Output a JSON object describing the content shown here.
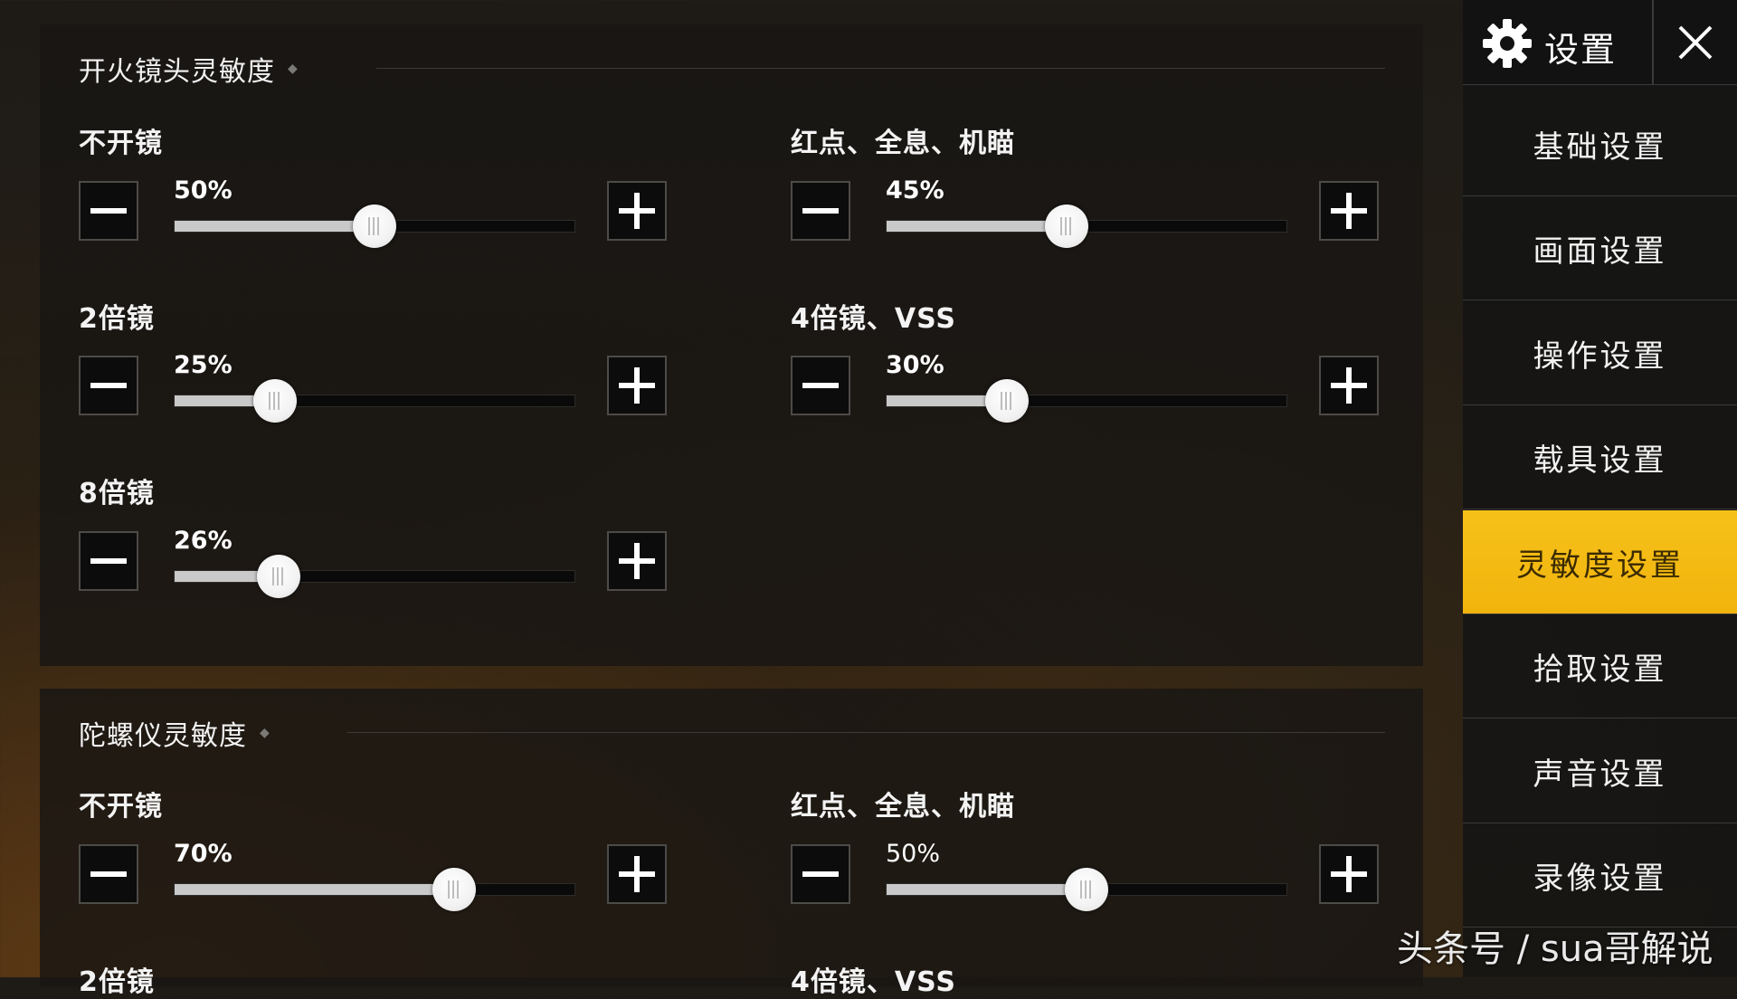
{
  "sections": [
    {
      "title": "开火镜头灵敏度",
      "marker": "◆",
      "settings": [
        {
          "label": "不开镜",
          "value": 50,
          "value_text": "50%"
        },
        {
          "label": "红点、全息、机瞄",
          "value": 45,
          "value_text": "45%"
        },
        {
          "label": "2倍镜",
          "value": 25,
          "value_text": "25%"
        },
        {
          "label": "4倍镜、VSS",
          "value": 30,
          "value_text": "30%"
        },
        {
          "label": "8倍镜",
          "value": 26,
          "value_text": "26%"
        }
      ]
    },
    {
      "title": "陀螺仪灵敏度",
      "marker": "◆",
      "settings": [
        {
          "label": "不开镜",
          "value": 70,
          "value_text": "70%"
        },
        {
          "label": "红点、全息、机瞄",
          "value": 50,
          "value_text": "50%"
        },
        {
          "label": "2倍镜"
        },
        {
          "label": "4倍镜、VSS"
        }
      ]
    }
  ],
  "sidebar": {
    "title": "设置",
    "gear_icon": "gear-icon",
    "close_icon": "close-icon",
    "items": [
      {
        "label": "基础设置",
        "active": false
      },
      {
        "label": "画面设置",
        "active": false
      },
      {
        "label": "操作设置",
        "active": false
      },
      {
        "label": "载具设置",
        "active": false
      },
      {
        "label": "灵敏度设置",
        "active": true
      },
      {
        "label": "拾取设置",
        "active": false
      },
      {
        "label": "声音设置",
        "active": false
      },
      {
        "label": "录像设置",
        "active": false
      }
    ]
  },
  "watermark": "头条号 / sua哥解说",
  "colors": {
    "accent": "#f5bd14",
    "track_fill": "#c9c9c9",
    "panel": "#181614"
  }
}
